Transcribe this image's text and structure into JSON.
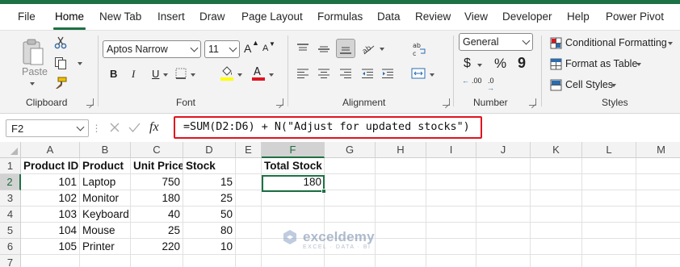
{
  "menu": {
    "tabs": [
      "File",
      "Home",
      "New Tab",
      "Insert",
      "Draw",
      "Page Layout",
      "Formulas",
      "Data",
      "Review",
      "View",
      "Developer",
      "Help",
      "Power Pivot"
    ],
    "active": "Home"
  },
  "ribbon": {
    "clipboard": {
      "label": "Clipboard",
      "paste_label": "Paste"
    },
    "font": {
      "label": "Font",
      "name": "Aptos Narrow",
      "size": "11",
      "bold": "B",
      "italic": "I",
      "underline": "U",
      "grow": "A",
      "shrink": "A"
    },
    "alignment": {
      "label": "Alignment"
    },
    "number": {
      "label": "Number",
      "format": "General",
      "currency": "$",
      "percent": "%",
      "comma": "9",
      "inc_decimal": ".00",
      "dec_decimal": ".0"
    },
    "styles": {
      "label": "Styles",
      "conditional": "Conditional Formatting",
      "table": "Format as Table",
      "cell_styles": "Cell Styles"
    }
  },
  "formula_bar": {
    "name_box": "F2",
    "fx": "fx",
    "formula": "=SUM(D2:D6) + N(\"Adjust for updated stocks\")"
  },
  "colors": {
    "accent": "#1e7145",
    "highlight_border": "#e0141e",
    "font_color_bar": "#e0141e",
    "fill_color_bar": "#ffff00"
  },
  "sheet": {
    "columns": [
      "A",
      "B",
      "C",
      "D",
      "E",
      "F",
      "G",
      "H",
      "I",
      "J",
      "K",
      "L",
      "M"
    ],
    "rows": [
      "1",
      "2",
      "3",
      "4",
      "5",
      "6",
      "7"
    ],
    "selected_col": "F",
    "selected_row": "2",
    "headers": [
      "Product ID",
      "Product",
      "Unit Price",
      "Stock"
    ],
    "data": [
      [
        "101",
        "Laptop",
        "750",
        "15"
      ],
      [
        "102",
        "Monitor",
        "180",
        "25"
      ],
      [
        "103",
        "Keyboard",
        "40",
        "50"
      ],
      [
        "104",
        "Mouse",
        "25",
        "80"
      ],
      [
        "105",
        "Printer",
        "220",
        "10"
      ]
    ],
    "total_label": "Total Stock",
    "total_value": "180"
  },
  "watermark": {
    "name": "exceldemy",
    "tagline": "EXCEL · DATA · BI"
  }
}
